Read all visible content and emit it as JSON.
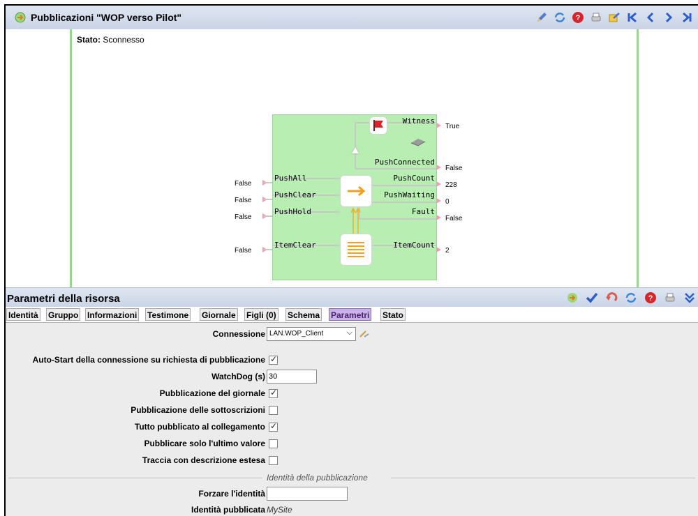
{
  "header": {
    "title": "Pubblicazioni \"WOP verso Pilot\""
  },
  "canvas": {
    "stato_label": "Stato:",
    "stato_value": "Sconnesso",
    "inputs": [
      {
        "name": "PushAll",
        "value": "False"
      },
      {
        "name": "PushClear",
        "value": "False"
      },
      {
        "name": "PushHold",
        "value": "False"
      },
      {
        "name": "ItemClear",
        "value": "False"
      }
    ],
    "outputs": [
      {
        "name": "Witness",
        "value": "True"
      },
      {
        "name": "PushConnected",
        "value": "False"
      },
      {
        "name": "PushCount",
        "value": "228"
      },
      {
        "name": "PushWaiting",
        "value": "0"
      },
      {
        "name": "Fault",
        "value": "False"
      },
      {
        "name": "ItemCount",
        "value": "2"
      }
    ]
  },
  "params": {
    "title": "Parametri della risorsa",
    "tabs": [
      "Identità",
      "Gruppo",
      "Informazioni",
      "Testimone",
      "Giornale",
      "Figli (0)",
      "Schema",
      "Parametri",
      "Stato"
    ],
    "active_tab": "Parametri",
    "connessione_label": "Connessione",
    "connessione_value": "LAN.WOP_Client",
    "autostart_label": "Auto-Start della connessione su richiesta di pubblicazione",
    "watchdog_label": "WatchDog (s)",
    "watchdog_value": "30",
    "pub_giornale_label": "Pubblicazione del giornale",
    "pub_sottoscrizioni_label": "Pubblicazione delle sottoscrizioni",
    "tutto_pubblicato_label": "Tutto pubblicato al collegamento",
    "ultimo_valore_label": "Pubblicare solo l'ultimo valore",
    "traccia_label": "Traccia con descrizione estesa",
    "section_label": "Identità della pubblicazione",
    "forzare_label": "Forzare l'identità",
    "forzare_value": "",
    "identita_pubblicata_label": "Identità pubblicata",
    "identita_pubblicata_value": "MySite",
    "checks": {
      "autostart": true,
      "giornale": true,
      "sottoscrizioni": false,
      "tutto": true,
      "ultimo": false,
      "traccia": false
    }
  },
  "colors": {
    "header_bg": "#c9d4e6",
    "diagram_bg": "#b8eeb2",
    "active_tab": "#c9b3e6",
    "form_bg": "#ececec"
  },
  "icons": [
    "refresh-icon",
    "edit-icon",
    "reload-icon",
    "help-icon",
    "print-icon",
    "export-icon",
    "first-icon",
    "prev-icon",
    "next-icon",
    "last-icon"
  ]
}
